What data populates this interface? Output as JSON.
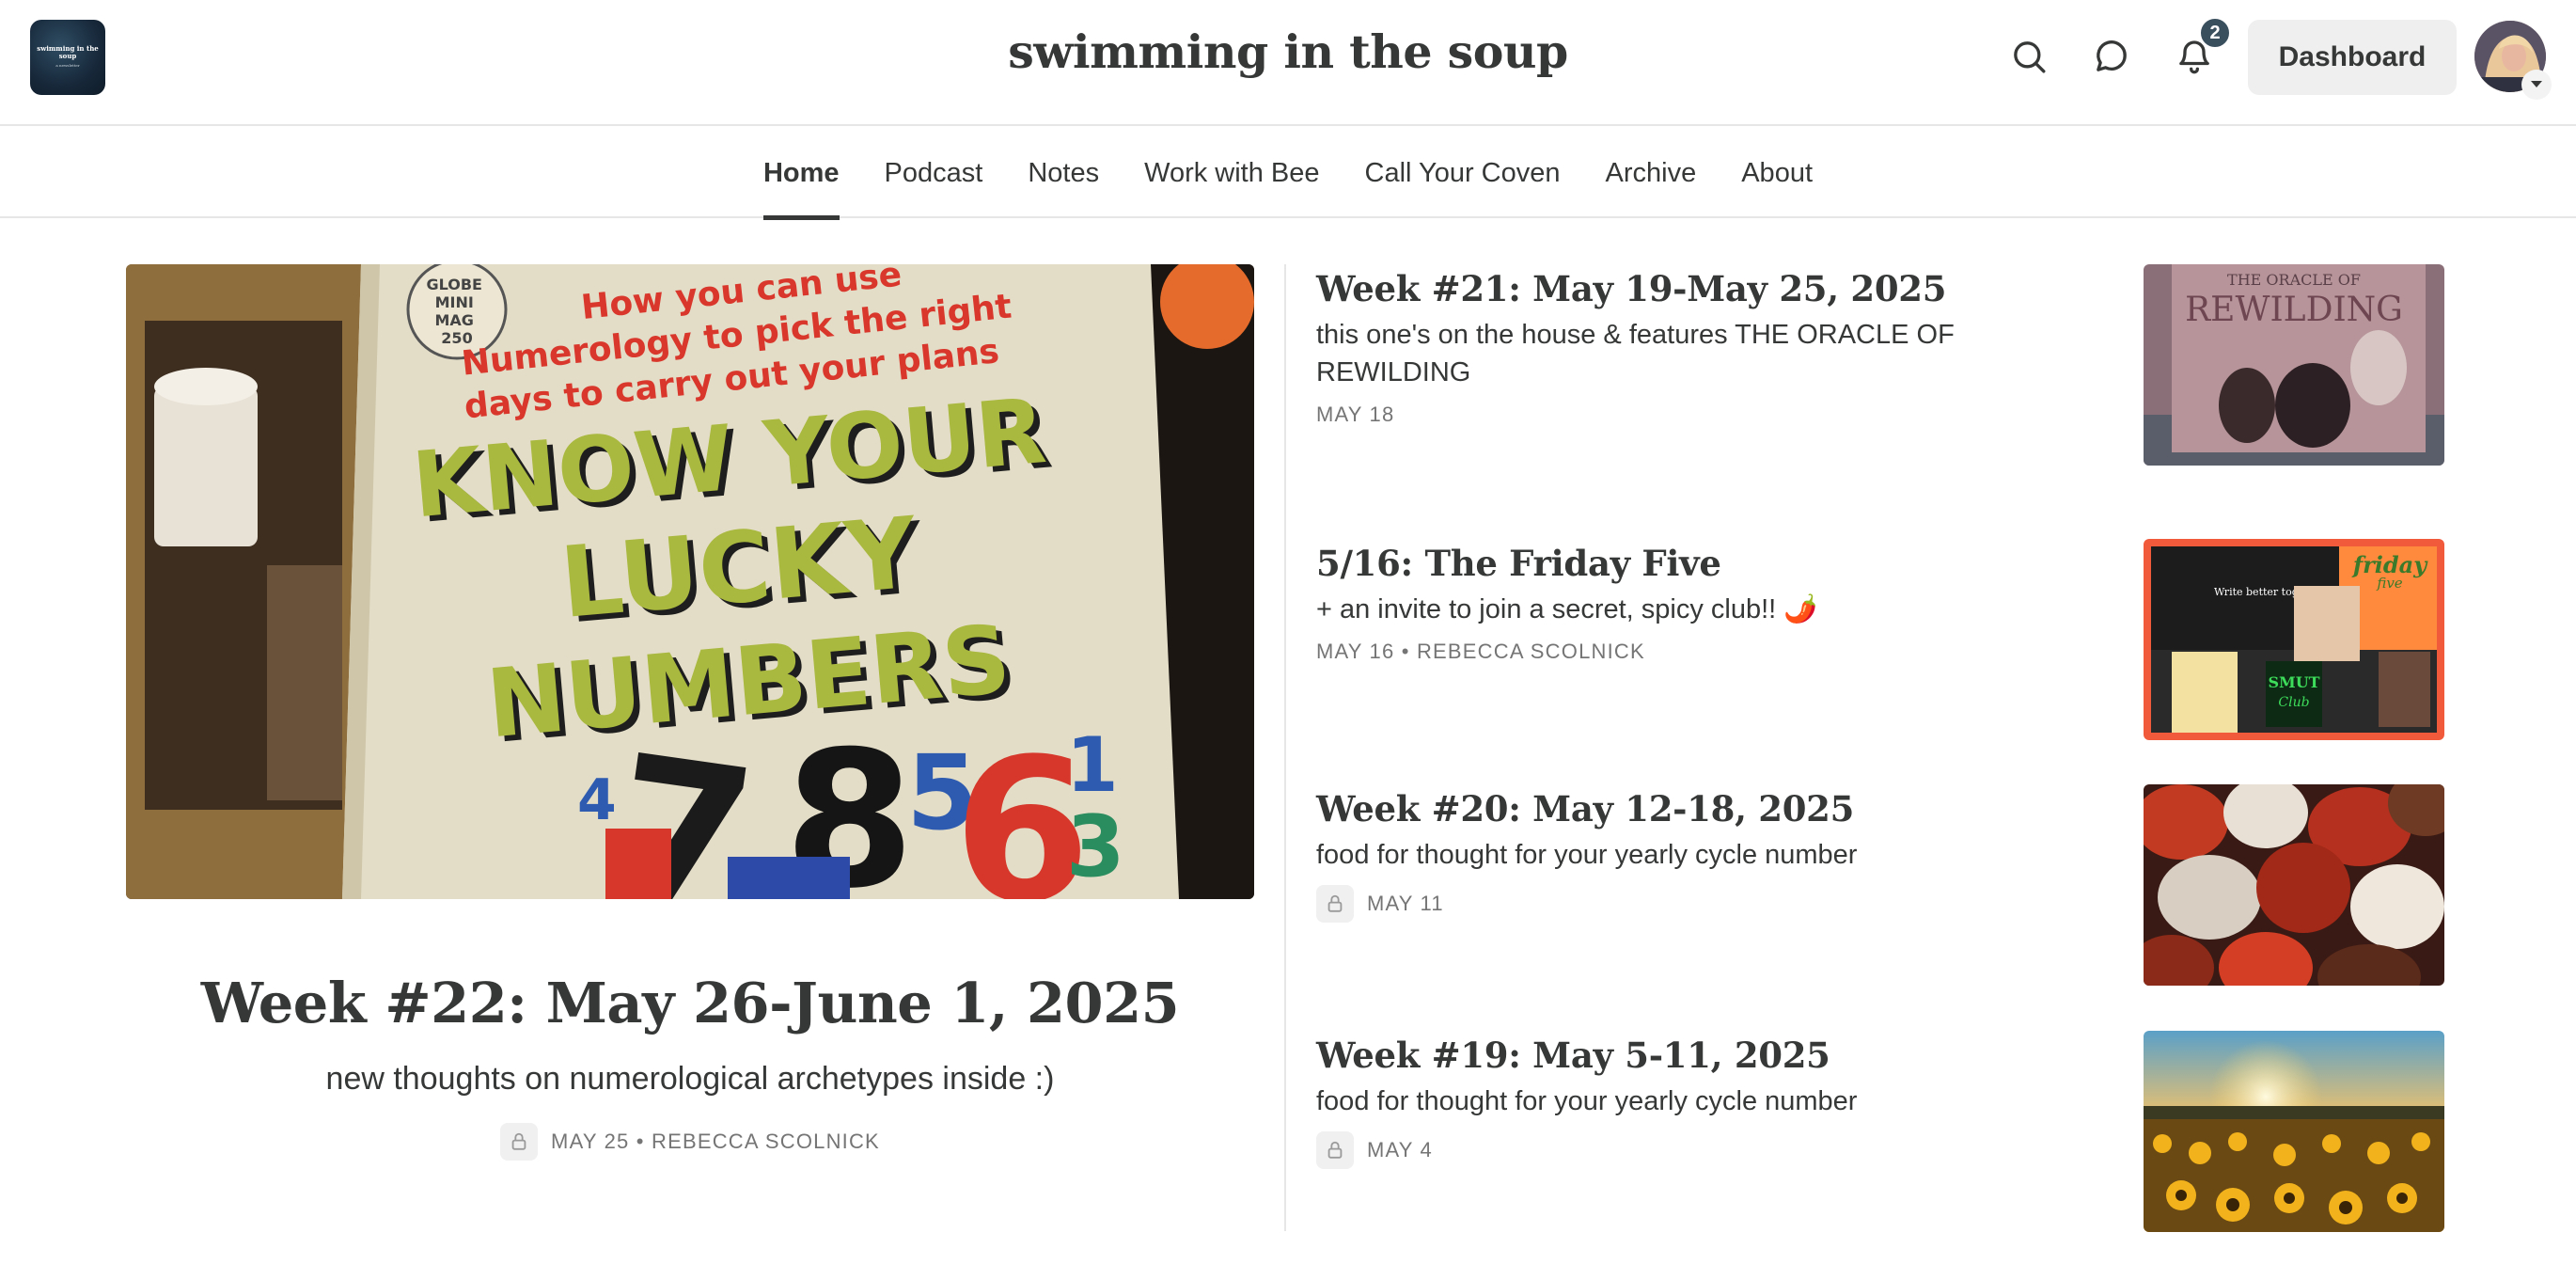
{
  "header": {
    "logo_text": "swimming in the soup",
    "logo_subtext": "a newsletter",
    "site_title": "swimming in the soup",
    "search_icon": "search-icon",
    "chat_icon": "chat-bubble-icon",
    "bell_icon": "bell-icon",
    "notification_count": "2",
    "dashboard_label": "Dashboard"
  },
  "nav": {
    "items": [
      {
        "label": "Home",
        "active": true
      },
      {
        "label": "Podcast"
      },
      {
        "label": "Notes"
      },
      {
        "label": "Work with Bee"
      },
      {
        "label": "Call Your Coven"
      },
      {
        "label": "Archive"
      },
      {
        "label": "About"
      }
    ]
  },
  "featured": {
    "title": "Week #22: May 26-June 1, 2025",
    "subtitle": "new thoughts on numerological archetypes inside :)",
    "meta": "MAY 25 • REBECCA SCOLNICK",
    "locked": true,
    "image": {
      "sticker": [
        "GLOBE",
        "MINI",
        "MAG",
        "250"
      ],
      "tagline": [
        "How you can use",
        "Numerology to pick the right",
        "days to carry out your plans"
      ],
      "headline": [
        "KNOW YOUR",
        "LUCKY",
        "NUMBERS"
      ]
    }
  },
  "posts": [
    {
      "title": "Week #21: May 19-May 25, 2025",
      "subtitle": "this one's on the house & features THE ORACLE OF REWILDING",
      "meta": "MAY 18",
      "locked": false,
      "thumb_text": [
        "THE ORACLE OF",
        "REWILDING"
      ]
    },
    {
      "title": "5/16: The Friday Five",
      "subtitle": "+ an invite to join a secret, spicy club!! 🌶️",
      "meta": "MAY 16 • REBECCA SCOLNICK",
      "locked": false,
      "thumb_text": [
        "friday",
        "five",
        "Write better together.",
        "SMUT",
        "Club"
      ]
    },
    {
      "title": "Week #20: May 12-18, 2025",
      "subtitle": "food for thought for your yearly cycle number",
      "meta": "MAY 11",
      "locked": true
    },
    {
      "title": "Week #19: May 5-11, 2025",
      "subtitle": "food for thought for your yearly cycle number",
      "meta": "MAY 4",
      "locked": true
    }
  ],
  "colors": {
    "text": "#363737",
    "muted": "#757575",
    "badge": "#3a4f5e",
    "button_bg": "#efefef"
  }
}
